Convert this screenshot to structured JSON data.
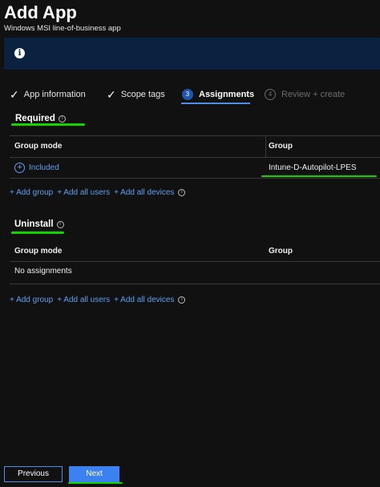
{
  "header": {
    "title": "Add App",
    "subtitle": "Windows MSI line-of-business app"
  },
  "info_banner": {
    "icon": "info-icon",
    "background": "#0a2240"
  },
  "steps": [
    {
      "label": "App information",
      "state": "done",
      "marker": "✓"
    },
    {
      "label": "Scope tags",
      "state": "done",
      "marker": "✓"
    },
    {
      "label": "Assignments",
      "state": "active",
      "marker": "3"
    },
    {
      "label": "Review + create",
      "state": "disabled",
      "marker": "4"
    }
  ],
  "required": {
    "title": "Required",
    "columns": [
      "Group mode",
      "Group"
    ],
    "rows": [
      {
        "mode": "Included",
        "group": "Intune-D-Autopilot-LPES"
      }
    ],
    "links": [
      "+ Add group",
      "+ Add all users",
      "+ Add all devices"
    ]
  },
  "uninstall": {
    "title": "Uninstall",
    "columns": [
      "Group mode",
      "Group"
    ],
    "empty_text": "No assignments",
    "links": [
      "+ Add group",
      "+ Add all users",
      "+ Add all devices"
    ]
  },
  "footer": {
    "previous_label": "Previous",
    "next_label": "Next"
  },
  "colors": {
    "accent": "#4f8ee8",
    "link": "#5ea0ef",
    "highlight_annotation": "#14d400"
  }
}
